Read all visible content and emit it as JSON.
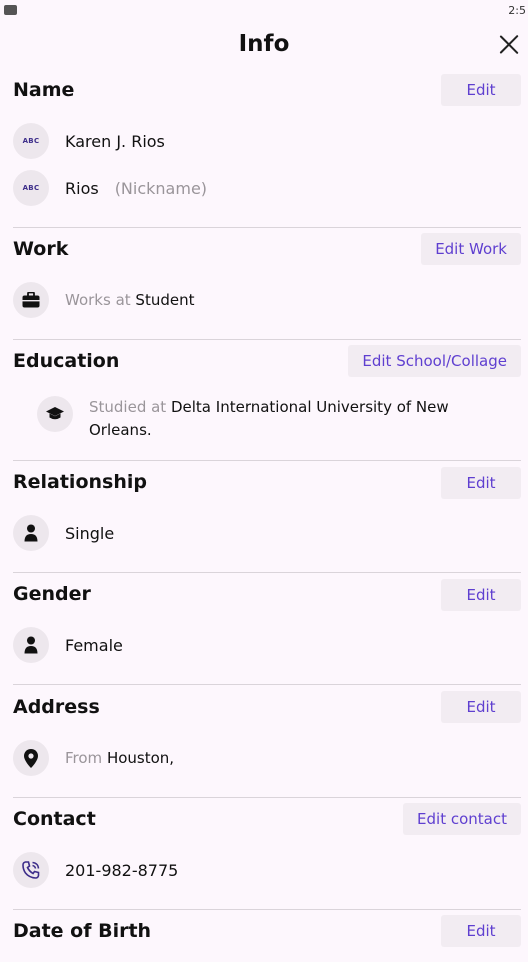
{
  "status_bar": {
    "time": "2:5"
  },
  "header": {
    "title": "Info"
  },
  "name": {
    "title": "Name",
    "edit_label": "Edit",
    "full_name": "Karen J. Rios",
    "short_name": "Rios",
    "nickname_hint": "(Nickname)",
    "abc": "ABC"
  },
  "work": {
    "title": "Work",
    "edit_label": "Edit Work",
    "prefix": "Works at",
    "value": "Student"
  },
  "education": {
    "title": "Education",
    "edit_label": "Edit School/Collage",
    "prefix": "Studied at",
    "value_line1": "Delta International University of New",
    "value_line2": "Orleans."
  },
  "relationship": {
    "title": "Relationship",
    "edit_label": "Edit",
    "value": "Single"
  },
  "gender": {
    "title": "Gender",
    "edit_label": "Edit",
    "value": "Female"
  },
  "address": {
    "title": "Address",
    "edit_label": "Edit",
    "prefix": "From",
    "value": "Houston,"
  },
  "contact": {
    "title": "Contact",
    "edit_label": "Edit contact",
    "phone": "201-982-8775"
  },
  "dob": {
    "title": "Date of Birth",
    "edit_label": "Edit"
  }
}
